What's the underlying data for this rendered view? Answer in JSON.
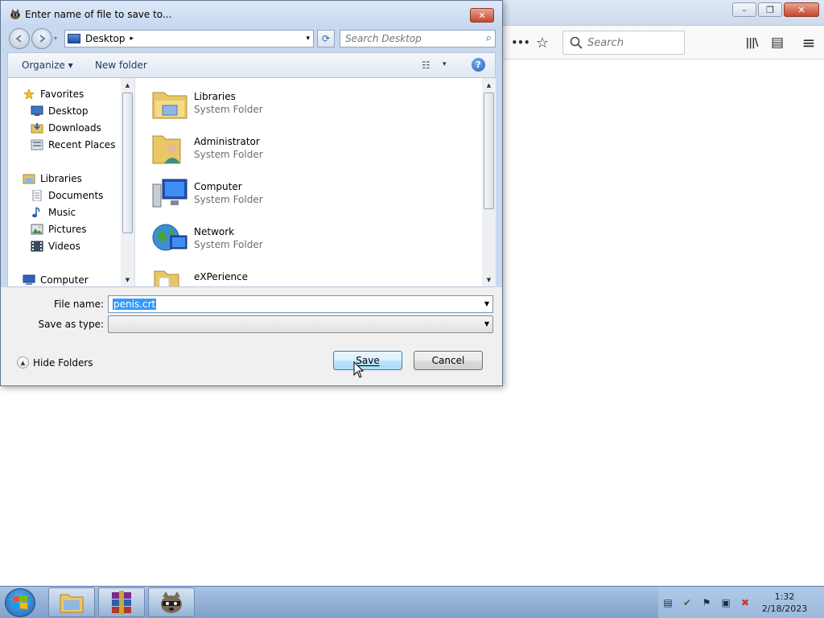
{
  "browser": {
    "search_placeholder": "Search",
    "minimize_glyph": "–",
    "restore_glyph": "❐",
    "close_glyph": "✕",
    "menu_dots": "•••",
    "bookmark_glyph": "☆",
    "library_glyph": "|||\\",
    "sidebar_glyph": "▤",
    "hamburger_glyph": "≡"
  },
  "dialog": {
    "title": "Enter name of file to save to...",
    "close_glyph": "✕",
    "address": {
      "location": "Desktop",
      "arrow": "▸",
      "dropdown": "▾"
    },
    "refresh_glyph": "⟳",
    "search_placeholder": "Search Desktop",
    "search_icon": "⌕",
    "commands": {
      "organize": "Organize ▾",
      "new_folder": "New folder",
      "view_icon": "☷",
      "view_drop": "▾",
      "help": "?"
    },
    "nav_tree": [
      {
        "label": "Favorites",
        "icon": "star-icon",
        "level": 0
      },
      {
        "label": "Desktop",
        "icon": "desktop-icon",
        "level": 1
      },
      {
        "label": "Downloads",
        "icon": "downloads-icon",
        "level": 1
      },
      {
        "label": "Recent Places",
        "icon": "recent-places-icon",
        "level": 1
      },
      {
        "label": "Libraries",
        "icon": "libraries-icon",
        "level": 0
      },
      {
        "label": "Documents",
        "icon": "documents-icon",
        "level": 1
      },
      {
        "label": "Music",
        "icon": "music-icon",
        "level": 1
      },
      {
        "label": "Pictures",
        "icon": "pictures-icon",
        "level": 1
      },
      {
        "label": "Videos",
        "icon": "videos-icon",
        "level": 1
      },
      {
        "label": "Computer",
        "icon": "computer-icon",
        "level": 0
      }
    ],
    "files": [
      {
        "name": "Libraries",
        "type": "System Folder",
        "icon": "libraries-folder-icon"
      },
      {
        "name": "Administrator",
        "type": "System Folder",
        "icon": "user-folder-icon"
      },
      {
        "name": "Computer",
        "type": "System Folder",
        "icon": "computer-icon"
      },
      {
        "name": "Network",
        "type": "System Folder",
        "icon": "network-icon"
      },
      {
        "name": "eXPerience",
        "type": "",
        "icon": "folder-icon"
      }
    ],
    "file_name_label": "File name:",
    "file_name_value": "penis.crt",
    "save_as_type_label": "Save as type:",
    "save_as_type_value": "",
    "hide_folders": "Hide Folders",
    "save_button": "Save",
    "cancel_button": "Cancel"
  },
  "taskbar": {
    "time": "1:32",
    "date": "2/18/2023",
    "apps": [
      "explorer-icon",
      "winrar-icon",
      "raccoon-app-icon"
    ]
  },
  "colors": {
    "dialog_frame": "#c8d9ee",
    "selection": "#3399ff",
    "taskbar": "#7fa1cc"
  }
}
